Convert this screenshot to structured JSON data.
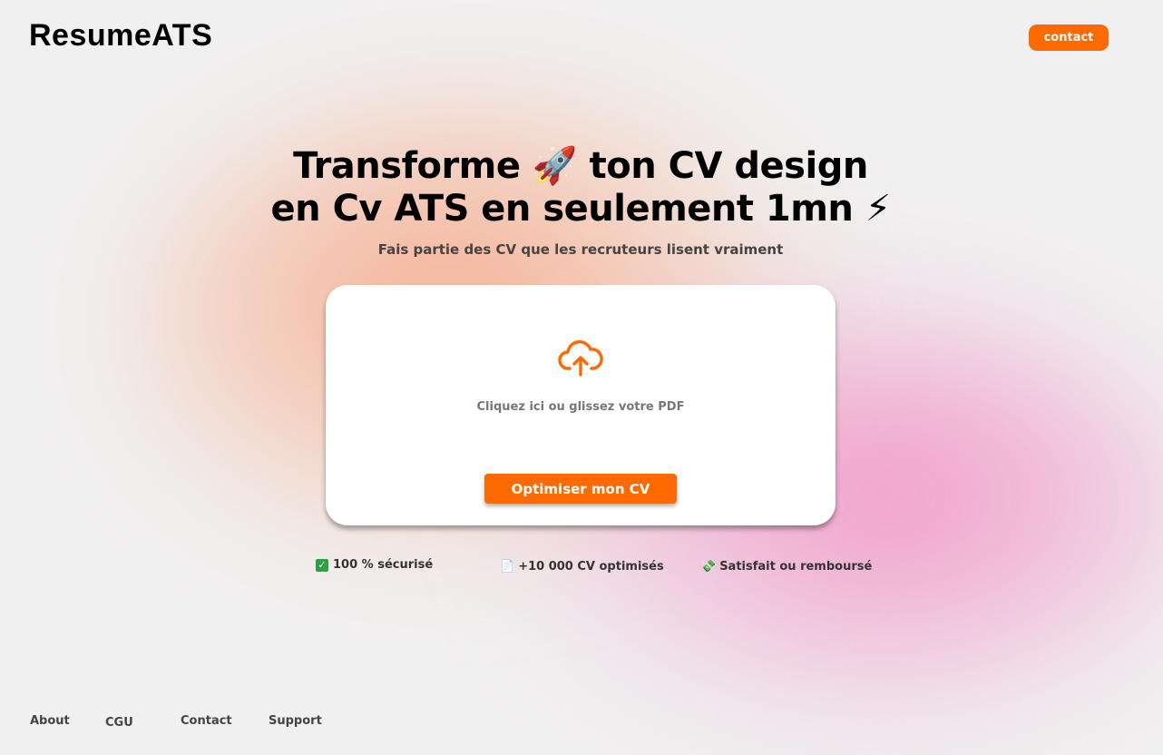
{
  "header": {
    "logo": "ResumeATS",
    "contact_label": "contact"
  },
  "hero": {
    "title_line1_a": "Transforme",
    "title_line1_emoji": "🚀",
    "title_line1_b": "ton CV design",
    "title_line2": "en Cv ATS en seulement 1mn",
    "title_line2_emoji": "⚡",
    "subtitle": "Fais partie des CV que les recruteurs lisent vraiment"
  },
  "upload": {
    "icon": "cloud-upload-icon",
    "prompt": "Cliquez ici ou glissez votre PDF",
    "button_label": "Optimiser mon CV"
  },
  "features": [
    {
      "icon": "✅",
      "label": "100 % sécurisé"
    },
    {
      "icon": "📄",
      "label": "+10 000 CV optimisés"
    },
    {
      "icon": "💸",
      "label": "Satisfait ou remboursé"
    }
  ],
  "footer": {
    "links": [
      "About",
      "CGU",
      "Contact",
      "Support"
    ]
  },
  "colors": {
    "accent": "#ff6a00",
    "background": "#f1f0f0",
    "glow_orange": "#f8966e",
    "glow_pink": "#f278b9"
  }
}
